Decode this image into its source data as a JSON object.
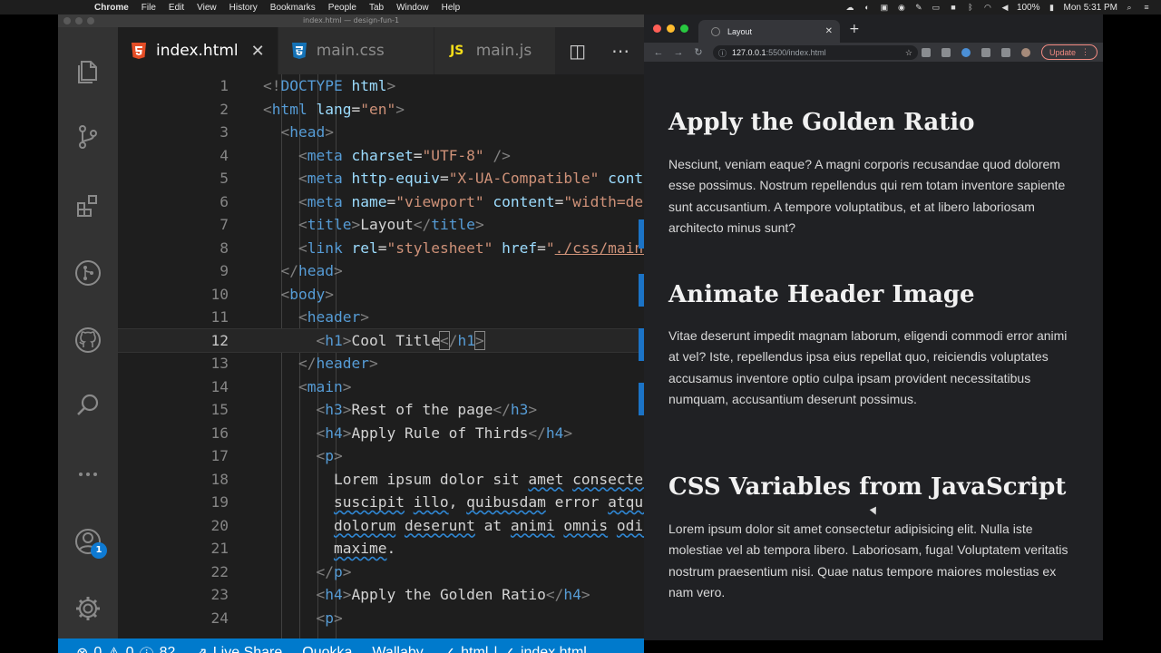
{
  "menubar": {
    "app": "Chrome",
    "items": [
      "File",
      "Edit",
      "View",
      "History",
      "Bookmarks",
      "People",
      "Tab",
      "Window",
      "Help"
    ],
    "battery": "100%",
    "clock": "Mon 5:31 PM"
  },
  "vscode": {
    "window_title": "index.html — design-fun-1",
    "tabs": [
      {
        "label": "index.html",
        "icon": "html5-icon",
        "icon_color": "#e44d26",
        "active": true
      },
      {
        "label": "main.css",
        "icon": "css3-icon",
        "icon_color": "#42a5f5",
        "active": false
      },
      {
        "label": "main.js",
        "icon": "js-icon",
        "icon_color": "#f5de19",
        "active": false
      }
    ],
    "js_icon_text": "JS",
    "activity": [
      "files-icon",
      "source-control-icon",
      "extensions-icon",
      "gitlens-icon",
      "github-icon",
      "search-icon",
      "more-icon",
      "accounts-icon",
      "settings-gear-icon"
    ],
    "account_badge": "1",
    "lines": [
      {
        "n": "1",
        "html": "<span class='t-br'>&lt;!</span><span class='t-tag'>DOCTYPE</span> <span class='t-attr'>html</span><span class='t-br'>&gt;</span>"
      },
      {
        "n": "2",
        "html": "<span class='t-br'>&lt;</span><span class='t-tag'>html</span> <span class='t-attr'>lang</span>=<span class='t-str'>\"en\"</span><span class='t-br'>&gt;</span>"
      },
      {
        "n": "3",
        "html": "  <span class='t-br'>&lt;</span><span class='t-tag'>head</span><span class='t-br'>&gt;</span>"
      },
      {
        "n": "4",
        "html": "    <span class='t-br'>&lt;</span><span class='t-tag'>meta</span> <span class='t-attr'>charset</span>=<span class='t-str'>\"UTF-8\"</span> <span class='t-br'>/&gt;</span>"
      },
      {
        "n": "5",
        "html": "    <span class='t-br'>&lt;</span><span class='t-tag'>meta</span> <span class='t-attr'>http-equiv</span>=<span class='t-str'>\"X-UA-Compatible\"</span> <span class='t-attr'>content</span>="
      },
      {
        "n": "6",
        "html": "    <span class='t-br'>&lt;</span><span class='t-tag'>meta</span> <span class='t-attr'>name</span>=<span class='t-str'>\"viewport\"</span> <span class='t-attr'>content</span>=<span class='t-str'>\"width=device</span>"
      },
      {
        "n": "7",
        "html": "    <span class='t-br'>&lt;</span><span class='t-tag'>title</span><span class='t-br'>&gt;</span><span class='t-txt'>Layout</span><span class='t-br'>&lt;/</span><span class='t-tag'>title</span><span class='t-br'>&gt;</span>"
      },
      {
        "n": "8",
        "html": "    <span class='t-br'>&lt;</span><span class='t-tag'>link</span> <span class='t-attr'>rel</span>=<span class='t-str'>\"stylesheet\"</span> <span class='t-attr'>href</span>=<span class='t-str'>\"</span><span class='t-link'>./css/main.css</span>"
      },
      {
        "n": "9",
        "html": "  <span class='t-br'>&lt;/</span><span class='t-tag'>head</span><span class='t-br'>&gt;</span>"
      },
      {
        "n": "10",
        "html": "  <span class='t-br'>&lt;</span><span class='t-tag'>body</span><span class='t-br'>&gt;</span>"
      },
      {
        "n": "11",
        "html": "    <span class='t-br'>&lt;</span><span class='t-tag'>header</span><span class='t-br'>&gt;</span>"
      },
      {
        "n": "12",
        "html": "      <span class='t-br'>&lt;</span><span class='t-tag'>h1</span><span class='t-br'>&gt;</span><span class='t-txt'>Cool Title</span><span class='t-br' style='outline:1px solid #888'>&lt;</span><span class='t-br'>/</span><span class='t-tag'>h1</span><span class='t-br' style='outline:1px solid #888'>&gt;</span>",
        "current": true
      },
      {
        "n": "13",
        "html": "    <span class='t-br'>&lt;/</span><span class='t-tag'>header</span><span class='t-br'>&gt;</span>"
      },
      {
        "n": "14",
        "html": "    <span class='t-br'>&lt;</span><span class='t-tag'>main</span><span class='t-br'>&gt;</span>"
      },
      {
        "n": "15",
        "html": "      <span class='t-br'>&lt;</span><span class='t-tag'>h3</span><span class='t-br'>&gt;</span><span class='t-txt'>Rest of the page</span><span class='t-br'>&lt;/</span><span class='t-tag'>h3</span><span class='t-br'>&gt;</span>"
      },
      {
        "n": "16",
        "html": "      <span class='t-br'>&lt;</span><span class='t-tag'>h4</span><span class='t-br'>&gt;</span><span class='t-txt'>Apply Rule of Thirds</span><span class='t-br'>&lt;/</span><span class='t-tag'>h4</span><span class='t-br'>&gt;</span>"
      },
      {
        "n": "17",
        "html": "      <span class='t-br'>&lt;</span><span class='t-tag'>p</span><span class='t-br'>&gt;</span>"
      },
      {
        "n": "18",
        "html": "        <span class='t-txt'>Lorem ipsum dolor sit <span class='wavy'>amet</span> <span class='wavy'>consectetur</span></span>"
      },
      {
        "n": "19",
        "html": "        <span class='t-txt'><span class='wavy'>suscipit</span> <span class='wavy'>illo</span>, <span class='wavy'>quibusdam</span> error <span class='wavy'>atque</span> <span class='wavy'>pr</span></span>"
      },
      {
        "n": "20",
        "html": "        <span class='t-txt'><span class='wavy'>dolorum</span> <span class='wavy'>deserunt</span> at <span class='wavy'>animi</span> <span class='wavy'>omnis</span> <span class='wavy'>odit</span> <span class='wavy'>vo</span></span>"
      },
      {
        "n": "21",
        "html": "        <span class='t-txt'><span class='wavy'>maxime</span>.</span>"
      },
      {
        "n": "22",
        "html": "      <span class='t-br'>&lt;/</span><span class='t-tag'>p</span><span class='t-br'>&gt;</span>"
      },
      {
        "n": "23",
        "html": "      <span class='t-br'>&lt;</span><span class='t-tag'>h4</span><span class='t-br'>&gt;</span><span class='t-txt'>Apply the Golden Ratio</span><span class='t-br'>&lt;/</span><span class='t-tag'>h4</span><span class='t-br'>&gt;</span>"
      },
      {
        "n": "24",
        "html": "      <span class='t-br'>&lt;</span><span class='t-tag'>p</span><span class='t-br'>&gt;</span>"
      }
    ],
    "status": {
      "errors": "0",
      "warnings": "0",
      "info": "82",
      "live_share": "Live Share",
      "quokka": "Quokka",
      "wallaby": "Wallaby",
      "html": "html",
      "file": "index.html"
    }
  },
  "chrome": {
    "tab_title": "Layout",
    "url_host": "127.0.0.1",
    "url_path": ":5500/index.html",
    "update_label": "Update",
    "sections": [
      {
        "heading": "Apply the Golden Ratio",
        "body": "Nesciunt, veniam eaque? A magni corporis recusandae quod dolorem esse possimus. Nostrum repellendus qui rem totam inventore sapiente sunt accusantium. A tempore voluptatibus, et at libero laboriosam architecto minus sunt?"
      },
      {
        "heading": "Animate Header Image",
        "body": "Vitae deserunt impedit magnam laborum, eligendi commodi error animi at vel? Iste, repellendus ipsa eius repellat quo, reiciendis voluptates accusamus inventore optio culpa ipsam provident necessitatibus numquam, accusantium deserunt possimus."
      },
      {
        "heading": "CSS Variables from JavaScript",
        "body": "Lorem ipsum dolor sit amet consectetur adipisicing elit. Nulla iste molestiae vel ab tempora libero. Laboriosam, fuga! Voluptatem veritatis nostrum praesentium nisi. Quae natus tempore maiores molestias ex nam vero."
      }
    ]
  }
}
